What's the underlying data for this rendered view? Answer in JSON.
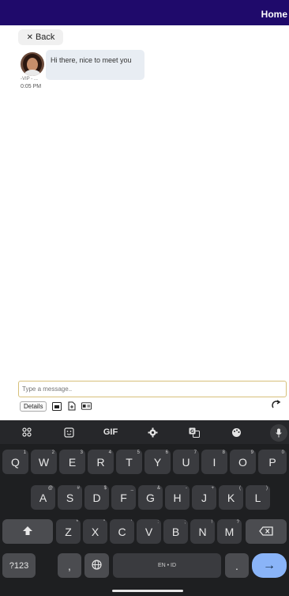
{
  "header": {
    "home_label": "Home",
    "bar_color": "#1f0a6b"
  },
  "back_button": {
    "label": "Back",
    "icon": "close-icon"
  },
  "conversation": {
    "messages": [
      {
        "sender": "-VIP - ...",
        "time": "0:05 PM",
        "text": "Hi there, nice to meet you",
        "avatar": "avatar"
      }
    ]
  },
  "composer": {
    "placeholder": "Type a message..",
    "details_label": "Details",
    "tools": [
      "image-icon",
      "file-icon",
      "card-icon"
    ],
    "redo_icon": "redo-icon",
    "accent_border": "#d7c07a"
  },
  "keyboard": {
    "toolbar": [
      "apps-icon",
      "sticker-icon",
      "GIF",
      "settings-icon",
      "translate-icon",
      "palette-icon",
      "mic-icon"
    ],
    "gif_label": "GIF",
    "row1": [
      {
        "k": "Q",
        "s": "1"
      },
      {
        "k": "W",
        "s": "2"
      },
      {
        "k": "E",
        "s": "3"
      },
      {
        "k": "R",
        "s": "4"
      },
      {
        "k": "T",
        "s": "5"
      },
      {
        "k": "Y",
        "s": "6"
      },
      {
        "k": "U",
        "s": "7"
      },
      {
        "k": "I",
        "s": "8"
      },
      {
        "k": "O",
        "s": "9"
      },
      {
        "k": "P",
        "s": "0"
      }
    ],
    "row2": [
      {
        "k": "A",
        "s": "@"
      },
      {
        "k": "S",
        "s": "#"
      },
      {
        "k": "D",
        "s": "$"
      },
      {
        "k": "F",
        "s": "_"
      },
      {
        "k": "G",
        "s": "&"
      },
      {
        "k": "H",
        "s": "-"
      },
      {
        "k": "J",
        "s": "+"
      },
      {
        "k": "K",
        "s": "("
      },
      {
        "k": "L",
        "s": ")"
      }
    ],
    "row3": [
      {
        "k": "Z",
        "s": "*"
      },
      {
        "k": "X",
        "s": "\""
      },
      {
        "k": "C",
        "s": "'"
      },
      {
        "k": "V",
        "s": ":"
      },
      {
        "k": "B",
        "s": ";"
      },
      {
        "k": "N",
        "s": "!"
      },
      {
        "k": "M",
        "s": "?"
      }
    ],
    "sym_label": "?123",
    "comma_label": ",",
    "space_label": "EN • ID",
    "period_label": ".",
    "enter_label": "→",
    "shift_icon": "shift-icon",
    "backspace_icon": "backspace-icon",
    "globe_icon": "globe-icon"
  }
}
